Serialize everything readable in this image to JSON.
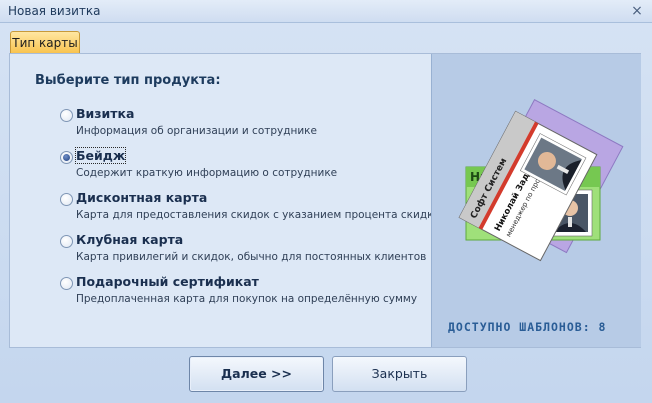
{
  "window": {
    "title": "Новая визитка",
    "close_glyph": "×"
  },
  "tab": {
    "label": "Тип карты"
  },
  "main": {
    "heading": "Выберите тип продукта:",
    "selected_index": 1,
    "options": [
      {
        "title": "Визитка",
        "description": "Информация об организации и сотруднике"
      },
      {
        "title": "Бейдж",
        "description": "Содержит краткую информацию о сотруднике"
      },
      {
        "title": "Дисконтная карта",
        "description": "Карта для предоставления скидок с указанием процента скидки"
      },
      {
        "title": "Клубная карта",
        "description": "Карта привилегий и скидок, обычно для постоянных клиентов"
      },
      {
        "title": "Подарочный сертификат",
        "description": "Предоплаченная карта для покупок на определённую сумму"
      }
    ]
  },
  "preview": {
    "badge_company": "Софт Систем",
    "badge_name": "Николай Задорнов",
    "badge_role": "менеджер по продажам",
    "green_card_text": "Ни",
    "templates_label": "ДОСТУПНО ШАБЛОНОВ: 8"
  },
  "buttons": {
    "next_label": "Далее >>",
    "close_label": "Закрыть"
  },
  "colors": {
    "tab_accent": "#f8c24c",
    "templates_text": "#2a5d96",
    "card_purple": "#b9a6e3",
    "card_green": "#9fe07a",
    "badge_red": "#d33b2c"
  }
}
